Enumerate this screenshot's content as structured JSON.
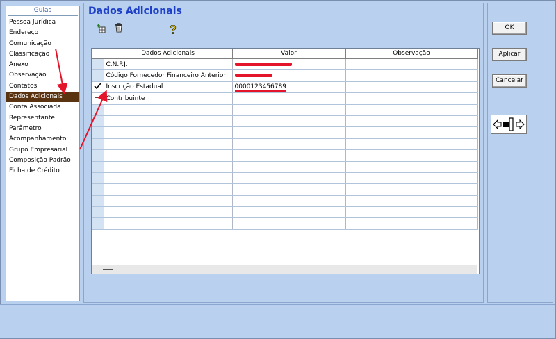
{
  "sidebar": {
    "title": "Guias",
    "items": [
      {
        "label": "Pessoa Jurídica",
        "selected": false
      },
      {
        "label": "Endereço",
        "selected": false
      },
      {
        "label": "Comunicação",
        "selected": false
      },
      {
        "label": "Classificação",
        "selected": false
      },
      {
        "label": "Anexo",
        "selected": false
      },
      {
        "label": "Observação",
        "selected": false
      },
      {
        "label": "Contatos",
        "selected": false
      },
      {
        "label": "Dados Adicionais",
        "selected": true
      },
      {
        "label": "Conta Associada",
        "selected": false
      },
      {
        "label": "Representante",
        "selected": false
      },
      {
        "label": "Parâmetro",
        "selected": false
      },
      {
        "label": "Acompanhamento",
        "selected": false
      },
      {
        "label": "Grupo Empresarial",
        "selected": false
      },
      {
        "label": "Composição Padrão",
        "selected": false
      },
      {
        "label": "Ficha de Crédito",
        "selected": false
      }
    ]
  },
  "main": {
    "title": "Dados Adicionais",
    "toolbar": {
      "add_icon": "add-row-icon",
      "delete_icon": "trash-icon",
      "help_icon": "help-icon"
    }
  },
  "grid": {
    "columns": [
      "Dados Adicionais",
      "Valor",
      "Observação"
    ],
    "rows": [
      {
        "marker": "",
        "label": "C.N.P.J.",
        "value": "",
        "value_redacted": true,
        "observacao": ""
      },
      {
        "marker": "",
        "label": "Código Fornecedor Financeiro Anterior",
        "value": "",
        "value_redacted": true,
        "observacao": ""
      },
      {
        "marker": "check",
        "label": "Inscrição Estadual",
        "value": "0000123456789",
        "value_redacted": false,
        "observacao": ""
      },
      {
        "marker": "dash",
        "label": "Contribuinte",
        "value": "",
        "value_redacted": false,
        "observacao": ""
      }
    ],
    "empty_rows": 11
  },
  "actions": {
    "ok": "OK",
    "apply": "Aplicar",
    "cancel": "Cancelar"
  },
  "colors": {
    "background": "#b9d1ee",
    "selected_item": "#5a3410",
    "title": "#1d3fc8",
    "annotation": "#e4152a"
  }
}
